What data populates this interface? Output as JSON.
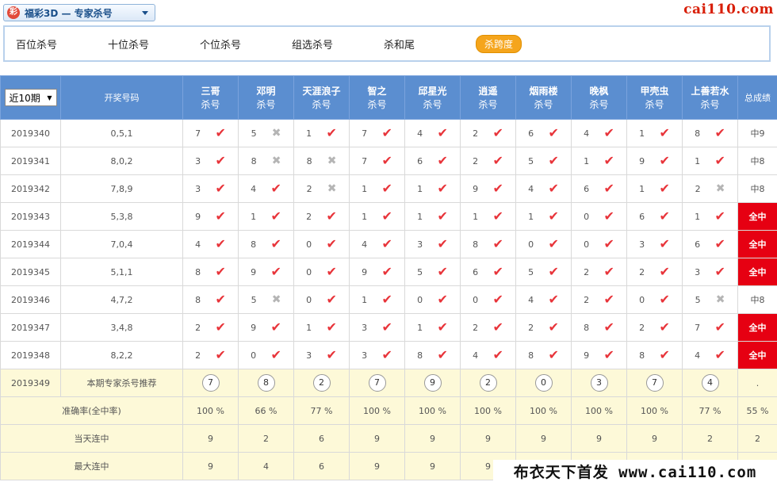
{
  "header": {
    "lottery_title": "福彩3D — 专家杀号",
    "logo_glyph": "彩",
    "site_mark": "cai110.com"
  },
  "nav": {
    "items": [
      "百位杀号",
      "十位杀号",
      "个位杀号",
      "组选杀号",
      "杀和尾"
    ],
    "active": "杀跨度"
  },
  "table": {
    "range_select": "近10期",
    "draw_header": "开奖号码",
    "total_header": "总成绩",
    "kill_label": "杀号",
    "experts": [
      "三哥",
      "邓明",
      "天涯浪子",
      "智之",
      "邱星光",
      "逍遥",
      "烟雨楼",
      "晚枫",
      "甲壳虫",
      "上善若水"
    ],
    "rows": [
      {
        "issue": "2019340",
        "draw": "0,5,1",
        "picks": [
          7,
          5,
          1,
          7,
          4,
          2,
          6,
          4,
          1,
          8
        ],
        "hit": [
          1,
          0,
          1,
          1,
          1,
          1,
          1,
          1,
          1,
          1
        ],
        "total": "中9",
        "all": false
      },
      {
        "issue": "2019341",
        "draw": "8,0,2",
        "picks": [
          3,
          8,
          8,
          7,
          6,
          2,
          5,
          1,
          9,
          1
        ],
        "hit": [
          1,
          0,
          0,
          1,
          1,
          1,
          1,
          1,
          1,
          1
        ],
        "total": "中8",
        "all": false
      },
      {
        "issue": "2019342",
        "draw": "7,8,9",
        "picks": [
          3,
          4,
          2,
          1,
          1,
          9,
          4,
          6,
          1,
          2
        ],
        "hit": [
          1,
          1,
          0,
          1,
          1,
          1,
          1,
          1,
          1,
          0
        ],
        "total": "中8",
        "all": false
      },
      {
        "issue": "2019343",
        "draw": "5,3,8",
        "picks": [
          9,
          1,
          2,
          1,
          1,
          1,
          1,
          0,
          6,
          1
        ],
        "hit": [
          1,
          1,
          1,
          1,
          1,
          1,
          1,
          1,
          1,
          1
        ],
        "total": "全中",
        "all": true
      },
      {
        "issue": "2019344",
        "draw": "7,0,4",
        "picks": [
          4,
          8,
          0,
          4,
          3,
          8,
          0,
          0,
          3,
          6
        ],
        "hit": [
          1,
          1,
          1,
          1,
          1,
          1,
          1,
          1,
          1,
          1
        ],
        "total": "全中",
        "all": true
      },
      {
        "issue": "2019345",
        "draw": "5,1,1",
        "picks": [
          8,
          9,
          0,
          9,
          5,
          6,
          5,
          2,
          2,
          3
        ],
        "hit": [
          1,
          1,
          1,
          1,
          1,
          1,
          1,
          1,
          1,
          1
        ],
        "total": "全中",
        "all": true
      },
      {
        "issue": "2019346",
        "draw": "4,7,2",
        "picks": [
          8,
          5,
          0,
          1,
          0,
          0,
          4,
          2,
          0,
          5
        ],
        "hit": [
          1,
          0,
          1,
          1,
          1,
          1,
          1,
          1,
          1,
          0
        ],
        "total": "中8",
        "all": false
      },
      {
        "issue": "2019347",
        "draw": "3,4,8",
        "picks": [
          2,
          9,
          1,
          3,
          1,
          2,
          2,
          8,
          2,
          7
        ],
        "hit": [
          1,
          1,
          1,
          1,
          1,
          1,
          1,
          1,
          1,
          1
        ],
        "total": "全中",
        "all": true
      },
      {
        "issue": "2019348",
        "draw": "8,2,2",
        "picks": [
          2,
          0,
          3,
          3,
          8,
          4,
          8,
          9,
          8,
          4
        ],
        "hit": [
          1,
          1,
          1,
          1,
          1,
          1,
          1,
          1,
          1,
          1
        ],
        "total": "全中",
        "all": true
      }
    ],
    "recommend": {
      "issue": "2019349",
      "label": "本期专家杀号推荐",
      "picks": [
        7,
        8,
        2,
        7,
        9,
        2,
        0,
        3,
        7,
        4
      ],
      "total": "."
    },
    "stats": [
      {
        "label": "准确率(全中率)",
        "values": [
          "100 %",
          "66 %",
          "77 %",
          "100 %",
          "100 %",
          "100 %",
          "100 %",
          "100 %",
          "100 %",
          "77 %"
        ],
        "total": "55 %"
      },
      {
        "label": "当天连中",
        "values": [
          "9",
          "2",
          "6",
          "9",
          "9",
          "9",
          "9",
          "9",
          "9",
          "2"
        ],
        "total": "2"
      },
      {
        "label": "最大连中",
        "values": [
          "9",
          "4",
          "6",
          "9",
          "9",
          "9",
          "",
          "",
          "",
          ""
        ],
        "total": ""
      }
    ]
  },
  "watermark": "布衣天下首发 www.cai110.com",
  "colors": {
    "header_blue": "#5b8ed0",
    "hit_red": "#e8343a",
    "allhit_bg": "#e60012",
    "pill": "#f5a51c"
  }
}
